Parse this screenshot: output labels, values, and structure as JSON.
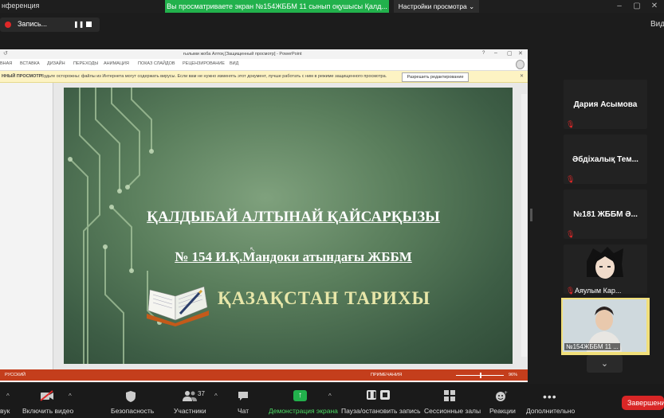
{
  "window": {
    "title": "нференция",
    "share_banner": "Вы просматриваете экран №154ЖББМ 11 сынып оқушысы Қалд...",
    "view_options": "Настройки просмотра ⌄",
    "view_mode": "Вид"
  },
  "recording": {
    "label": "Запись...",
    "pause_glyph": "❚❚"
  },
  "ppt": {
    "title": "ғылыми жоба Алтоқ [Защищенный просмотр] - PowerPoint",
    "tabs": [
      "ВНАЯ",
      "ВСТАВКА",
      "ДИЗАЙН",
      "ПЕРЕХОДЫ",
      "АНИМАЦИЯ",
      "ПОКАЗ СЛАЙДОВ",
      "РЕЦЕНЗИРОВАНИЕ",
      "ВИД"
    ],
    "protected_label": "ННЫЙ ПРОСМОТР",
    "protected_msg": "Будьте осторожны: файлы из Интернета могут содержать вирусы. Если вам не нужно изменять этот документ, лучше работать с ним в режиме защищенного просмотра.",
    "enable_editing": "Разрешить редактирование",
    "status_lang": "РУССКИЙ",
    "status_notes": "ПРИМЕЧАНИЯ",
    "status_zoom": "96%",
    "zoom_level": 0.5
  },
  "slide": {
    "line1": "ҚАЛДЫБАЙ АЛТЫНАЙ ҚАЙСАРҚЫЗЫ",
    "line2": "№ 154 И.Қ.Мандоки атындағы ЖББМ",
    "line3": "ҚАЗАҚСТАН ТАРИХЫ"
  },
  "participants": [
    {
      "name": "Дария Асымова"
    },
    {
      "name": "Әбдіхалық Тем..."
    },
    {
      "name": "№181 ЖББМ Ә..."
    },
    {
      "name": "Аяулым Кар..."
    },
    {
      "name": "№154ЖББМ 11 ..."
    }
  ],
  "toolbar": {
    "audio": "вук",
    "video": "Включить видео",
    "security": "Безопасность",
    "participants": "Участники",
    "participants_count": "37",
    "chat": "Чат",
    "share": "Демонстрация экрана",
    "record": "Пауза/остановить запись",
    "breakout": "Сессионные залы",
    "reactions": "Реакции",
    "more": "Дополнительно",
    "end": "Завершение"
  },
  "colors": {
    "share_green": "#22b14c",
    "end_red": "#d92626",
    "ppt_status": "#c43e1c"
  }
}
